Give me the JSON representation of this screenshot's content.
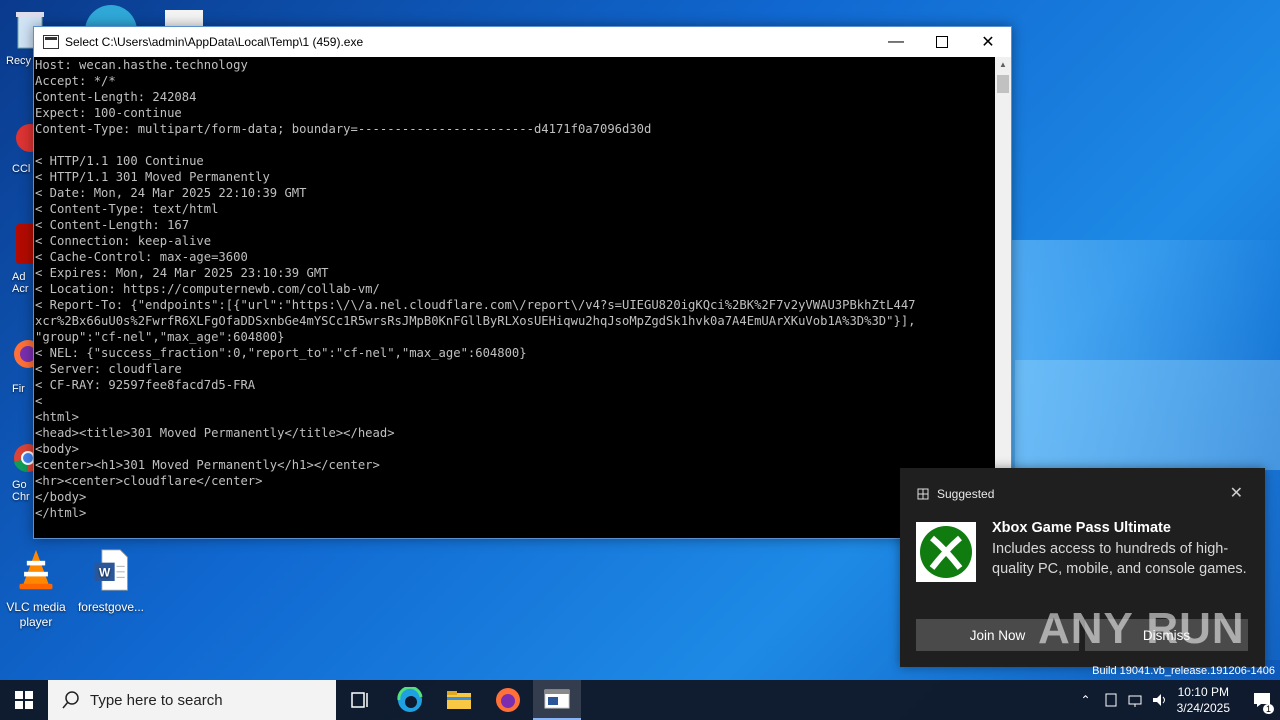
{
  "desktop": {
    "icons": [
      {
        "name": "recycle-bin",
        "label": "Recy"
      },
      {
        "name": "ccleaner",
        "label": "CCl"
      },
      {
        "name": "adobe",
        "label": "Ad\nAcr"
      },
      {
        "name": "firefox",
        "label": "Fir"
      },
      {
        "name": "chrome",
        "label": "Go\nChr"
      },
      {
        "name": "vlc",
        "label": "VLC media player"
      },
      {
        "name": "word-doc",
        "label": "forestgove..."
      }
    ],
    "build_text": "Build 19041.vb_release.191206-1406",
    "watermark": "ANY RUN"
  },
  "console": {
    "title": "Select C:\\Users\\admin\\AppData\\Local\\Temp\\1 (459).exe",
    "lines": [
      "Host: wecan.hasthe.technology",
      "Accept: */*",
      "Content-Length: 242084",
      "Expect: 100-continue",
      "Content-Type: multipart/form-data; boundary=------------------------d4171f0a7096d30d",
      "",
      "< HTTP/1.1 100 Continue",
      "< HTTP/1.1 301 Moved Permanently",
      "< Date: Mon, 24 Mar 2025 22:10:39 GMT",
      "< Content-Type: text/html",
      "< Content-Length: 167",
      "< Connection: keep-alive",
      "< Cache-Control: max-age=3600",
      "< Expires: Mon, 24 Mar 2025 23:10:39 GMT",
      "< Location: https://computernewb.com/collab-vm/",
      "< Report-To: {\"endpoints\":[{\"url\":\"https:\\/\\/a.nel.cloudflare.com\\/report\\/v4?s=UIEGU820igKQci%2BK%2F7v2yVWAU3PBkhZtL447",
      "xcr%2Bx66uU0s%2FwrfR6XLFgOfaDDSxnbGe4mYSCc1R5wrsRsJMpB0KnFGllByRLXosUEHiqwu2hqJsoMpZgdSk1hvk0a7A4EmUArXKuVob1A%3D%3D\"}],",
      "\"group\":\"cf-nel\",\"max_age\":604800}",
      "< NEL: {\"success_fraction\":0,\"report_to\":\"cf-nel\",\"max_age\":604800}",
      "< Server: cloudflare",
      "< CF-RAY: 92597fee8facd7d5-FRA",
      "<",
      "<html>",
      "<head><title>301 Moved Permanently</title></head>",
      "<body>",
      "<center><h1>301 Moved Permanently</h1></center>",
      "<hr><center>cloudflare</center>",
      "</body>",
      "</html>"
    ]
  },
  "toast": {
    "header": "Suggested",
    "title": "Xbox Game Pass Ultimate",
    "description": "Includes access to hundreds of high-quality PC, mobile, and console games.",
    "primary_button": "Join Now",
    "secondary_button": "Dismiss"
  },
  "taskbar": {
    "search_placeholder": "Type here to search",
    "time": "10:10 PM",
    "date": "3/24/2025",
    "notification_count": "1"
  }
}
